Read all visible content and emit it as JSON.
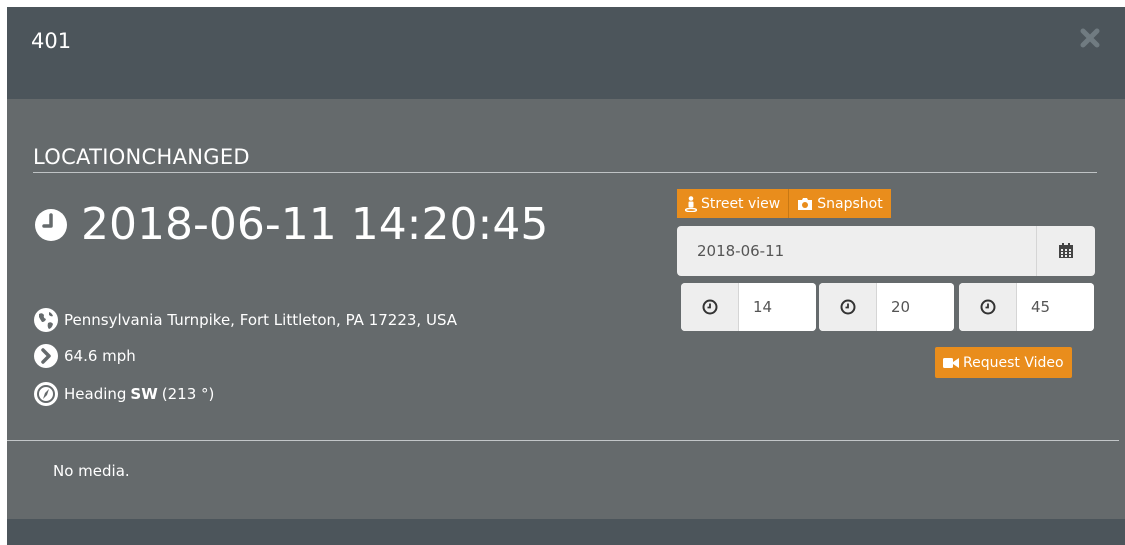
{
  "modal": {
    "title": "401",
    "close_icon": "close-icon"
  },
  "event": {
    "type": "LOCATIONCHANGED",
    "timestamp": "2018-06-11 14:20:45",
    "address": "Pennsylvania Turnpike, Fort Littleton, PA 17223, USA",
    "speed": "64.6 mph",
    "heading_label": "Heading",
    "heading_dir": "SW",
    "heading_deg": "(213 °)"
  },
  "actions": {
    "street_view": "Street view",
    "snapshot": "Snapshot",
    "request_video": "Request Video"
  },
  "datetime_form": {
    "date": "2018-06-11",
    "hour": "14",
    "minute": "20",
    "second": "45"
  },
  "media": {
    "empty_text": "No media."
  },
  "colors": {
    "header": "#4c555b",
    "body": "#656a6c",
    "accent": "#e98d1c"
  }
}
